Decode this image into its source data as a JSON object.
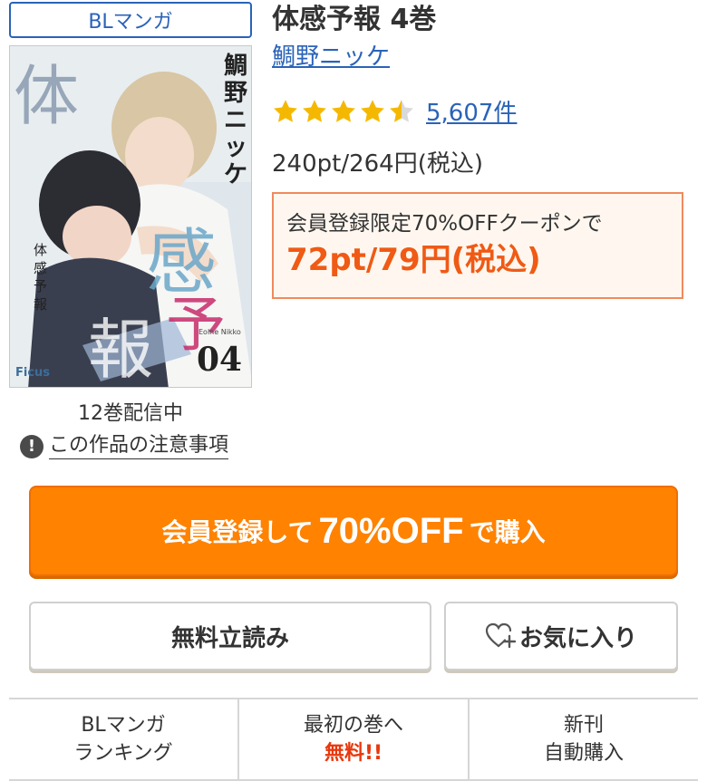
{
  "genre_tag": "BLマンガ",
  "book": {
    "title": "体感予報 4巻",
    "author": "鯛野ニッケ",
    "rating": 4.5,
    "review_count": "5,607件",
    "price": "240pt/264円(税込)",
    "coupon": {
      "label": "会員登録限定70%OFFクーポンで",
      "price": "72pt/79円(税込)"
    },
    "volumes_note": "12巻配信中",
    "caution_link": "この作品の注意事項"
  },
  "cover": {
    "title_chars": [
      "体",
      "感",
      "予",
      "報"
    ],
    "author_chars": [
      "鯛",
      "野",
      "ニ",
      "ッ",
      "ケ"
    ],
    "spine_text": [
      "体",
      "感",
      "予",
      "報"
    ],
    "volume": "04",
    "publisher": "Ficus",
    "credit": "Eolne Nikko"
  },
  "buttons": {
    "buy_prefix": "会員登録して",
    "buy_highlight": "70%OFF",
    "buy_suffix": "で購入",
    "trial": "無料立読み",
    "favorite": "お気に入り"
  },
  "bottom_nav": [
    {
      "line1": "BLマンガ",
      "line2": "ランキング"
    },
    {
      "line1": "最初の巻へ",
      "line2": "無料!!"
    },
    {
      "line1": "新刊",
      "line2": "自動購入"
    }
  ],
  "colors": {
    "link": "#2a63b8",
    "accent_orange": "#ff8200",
    "coupon_red": "#f05a14",
    "star": "#f5b800"
  },
  "icons": [
    "star-full-icon",
    "star-half-icon",
    "exclamation-circle-icon",
    "heart-plus-icon"
  ]
}
